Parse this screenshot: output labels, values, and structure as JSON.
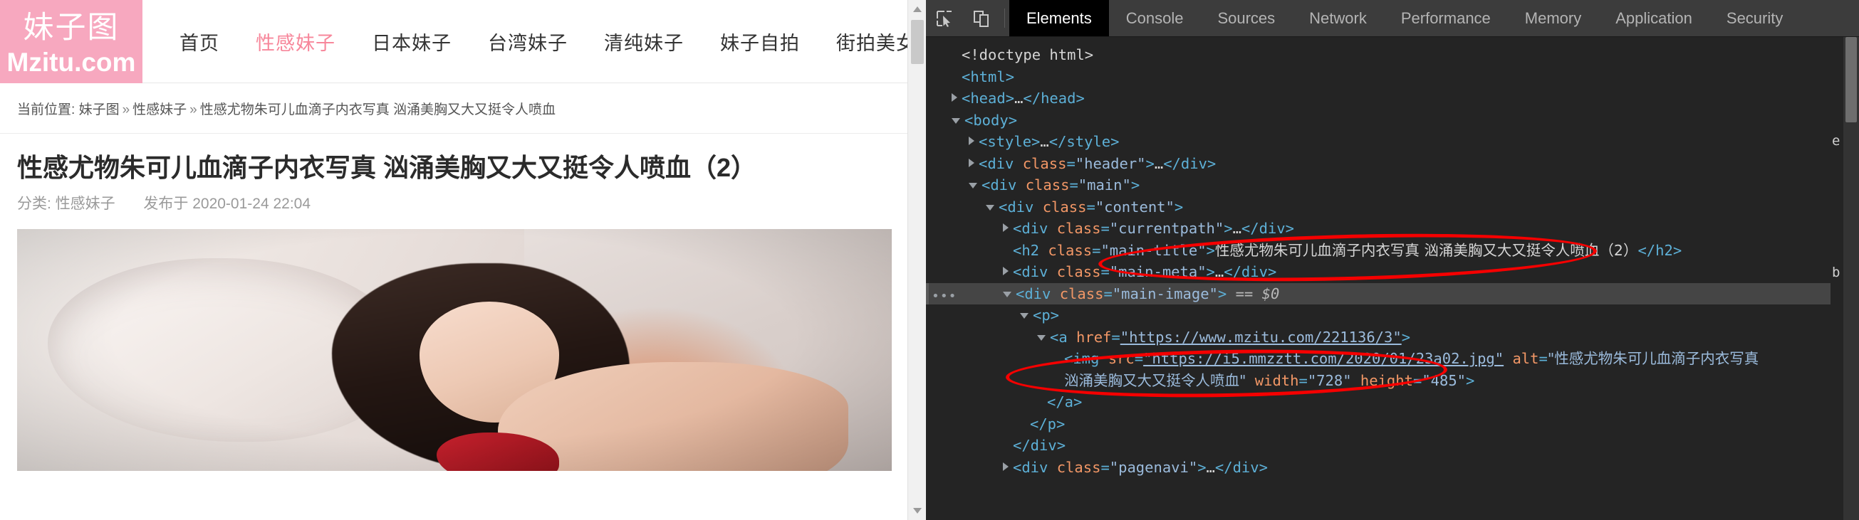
{
  "site": {
    "logo_cn": "妹子图",
    "logo_en": "Mzitu.com",
    "nav": [
      {
        "label": "首页",
        "active": false
      },
      {
        "label": "性感妹子",
        "active": true
      },
      {
        "label": "日本妹子",
        "active": false
      },
      {
        "label": "台湾妹子",
        "active": false
      },
      {
        "label": "清纯妹子",
        "active": false
      },
      {
        "label": "妹子自拍",
        "active": false
      },
      {
        "label": "街拍美女",
        "active": false
      }
    ],
    "accent_color": "#f7a8bf",
    "active_nav_color": "#f7879b"
  },
  "breadcrumb": {
    "prefix": "当前位置:",
    "item1": "妹子图",
    "sep1": "»",
    "item2": "性感妹子",
    "sep2": "»",
    "item3": "性感尤物朱可儿血滴子内衣写真 汹涌美胸又大又挺令人喷血"
  },
  "article": {
    "title": "性感尤物朱可儿血滴子内衣写真 汹涌美胸又大又挺令人喷血（2）",
    "category_label": "分类:",
    "category_value": "性感妹子",
    "published_label": "发布于",
    "published_value": "2020-01-24 22:04"
  },
  "page_scrollbar": {
    "up_icon": "triangle-up-icon",
    "down_icon": "triangle-down-icon"
  },
  "devtools": {
    "inspect_icon": "inspect-element-icon",
    "device_icon": "device-toolbar-icon",
    "tabs": [
      {
        "label": "Elements",
        "active": true
      },
      {
        "label": "Console",
        "active": false
      },
      {
        "label": "Sources",
        "active": false
      },
      {
        "label": "Network",
        "active": false
      },
      {
        "label": "Performance",
        "active": false
      },
      {
        "label": "Memory",
        "active": false
      },
      {
        "label": "Application",
        "active": false
      },
      {
        "label": "Security",
        "active": false
      }
    ],
    "dom_rows": [
      {
        "indent": 0,
        "tri": "blank",
        "html": "<span class=\"txt\">&lt;!doctype html&gt;</span>"
      },
      {
        "indent": 0,
        "tri": "blank",
        "html": "<span class=\"tag\">&lt;html&gt;</span>"
      },
      {
        "indent": 0,
        "tri": "closed",
        "html": "<span class=\"tag\">&lt;head&gt;</span><span class=\"txt\">…</span><span class=\"tag\">&lt;/head&gt;</span>"
      },
      {
        "indent": 0,
        "tri": "open",
        "html": "<span class=\"tag\">&lt;body&gt;</span>"
      },
      {
        "indent": 1,
        "tri": "closed",
        "html": "<span class=\"tag\">&lt;style&gt;</span><span class=\"txt\">…</span><span class=\"tag\">&lt;/style&gt;</span>"
      },
      {
        "indent": 1,
        "tri": "closed",
        "html": "<span class=\"tag\">&lt;div</span> <span class=\"attr\">class</span><span class=\"tag\">=</span><span class=\"val\">\"header\"</span><span class=\"tag\">&gt;</span><span class=\"txt\">…</span><span class=\"tag\">&lt;/div&gt;</span>"
      },
      {
        "indent": 1,
        "tri": "open",
        "html": "<span class=\"tag\">&lt;div</span> <span class=\"attr\">class</span><span class=\"tag\">=</span><span class=\"val\">\"main\"</span><span class=\"tag\">&gt;</span>"
      },
      {
        "indent": 2,
        "tri": "open",
        "html": "<span class=\"tag\">&lt;div</span> <span class=\"attr\">class</span><span class=\"tag\">=</span><span class=\"val\">\"content\"</span><span class=\"tag\">&gt;</span>"
      },
      {
        "indent": 3,
        "tri": "closed",
        "html": "<span class=\"tag\">&lt;div</span> <span class=\"attr\">class</span><span class=\"tag\">=</span><span class=\"val\">\"currentpath\"</span><span class=\"tag\">&gt;</span><span class=\"txt\">…</span><span class=\"tag\">&lt;/div&gt;</span>"
      },
      {
        "indent": 3,
        "tri": "blank",
        "html": "<span class=\"tag\">&lt;h2</span> <span class=\"attr\">class</span><span class=\"tag\">=</span><span class=\"val\">\"main-title\"</span><span class=\"tag\">&gt;</span><span class=\"txt cn\">性感尤物朱可儿血滴子内衣写真  汹涌美胸又大又挺令人喷血（2）</span><span class=\"tag\">&lt;/h2&gt;</span>"
      },
      {
        "indent": 3,
        "tri": "closed",
        "html": "<span class=\"tag\">&lt;div</span> <span class=\"attr\">class</span><span class=\"tag\">=</span><span class=\"val\">\"main-meta\"</span><span class=\"tag\">&gt;</span><span class=\"txt\">…</span><span class=\"tag\">&lt;/div&gt;</span>"
      },
      {
        "indent": 3,
        "tri": "open",
        "selected": true,
        "html": "<span class=\"tag\">&lt;div</span> <span class=\"attr\">class</span><span class=\"tag\">=</span><span class=\"val\">\"main-image\"</span><span class=\"tag\">&gt;</span> <span class=\"sel-marker\">== $0</span>"
      },
      {
        "indent": 4,
        "tri": "open",
        "html": "<span class=\"tag\">&lt;p&gt;</span>"
      },
      {
        "indent": 5,
        "tri": "open",
        "html": "<span class=\"tag\">&lt;a</span> <span class=\"attr\">href</span><span class=\"tag\">=</span><span class=\"val lnk\">\"https://www.mzitu.com/221136/3\"</span><span class=\"tag\">&gt;</span>"
      },
      {
        "indent": 6,
        "tri": "blank",
        "html": "<span class=\"tag\">&lt;img</span> <span class=\"attr\">src</span><span class=\"tag\">=</span><span class=\"val lnk\">\"https://i5.mmzztt.com/2020/01/23a02.jpg\"</span> <span class=\"attr\">alt</span><span class=\"tag\">=</span><span class=\"val cn\">\"性感尤物朱可儿血滴子内衣写真</span>"
      },
      {
        "indent": 6,
        "tri": "blank",
        "html": "<span class=\"val cn\">汹涌美胸又大又挺令人喷血\"</span> <span class=\"attr\">width</span><span class=\"tag\">=</span><span class=\"val\">\"728\"</span> <span class=\"attr\">height</span><span class=\"tag\">=</span><span class=\"val\">\"485\"</span><span class=\"tag\">&gt;</span>"
      },
      {
        "indent": 5,
        "tri": "blank",
        "html": "<span class=\"tag\">&lt;/a&gt;</span>"
      },
      {
        "indent": 4,
        "tri": "blank",
        "html": "<span class=\"tag\">&lt;/p&gt;</span>"
      },
      {
        "indent": 3,
        "tri": "blank",
        "html": "<span class=\"tag\">&lt;/div&gt;</span>"
      },
      {
        "indent": 3,
        "tri": "closed",
        "html": "<span class=\"tag\">&lt;div</span> <span class=\"attr\">class</span><span class=\"tag\">=</span><span class=\"val\">\"pagenavi\"</span><span class=\"tag\">&gt;</span><span class=\"txt\">…</span><span class=\"tag\">&lt;/div&gt;</span>"
      }
    ],
    "annotations": [
      {
        "name": "title-highlight"
      },
      {
        "name": "img-src-highlight"
      }
    ],
    "edge_stubs": [
      "e",
      "b"
    ]
  }
}
